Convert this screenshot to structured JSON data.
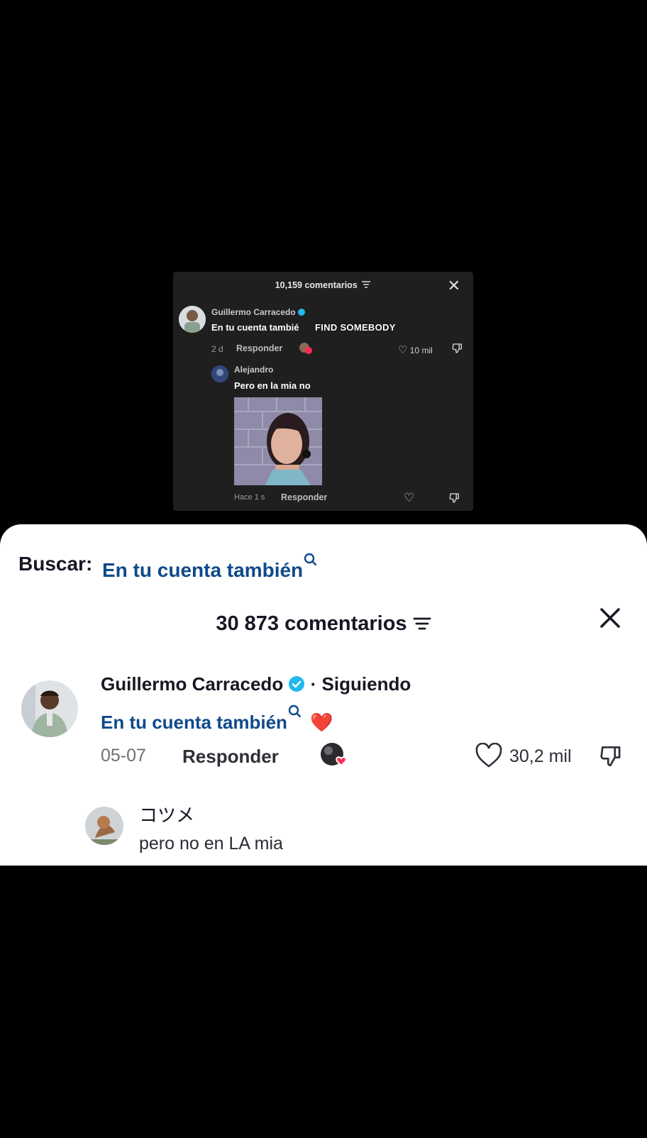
{
  "embedded": {
    "header_count": "10,159 comentarios",
    "comment": {
      "author": "Guillermo Carracedo",
      "text": "En tu cuenta tambié",
      "overlay_text": "FIND SOMEBODY",
      "time": "2 d",
      "reply_label": "Responder",
      "likes": "10 mil"
    },
    "reply": {
      "author": "Alejandro",
      "text": "Pero en la mia no",
      "time": "Hace 1 s",
      "reply_label": "Responder"
    }
  },
  "sheet": {
    "search_label": "Buscar:",
    "search_term": "En tu cuenta también",
    "count": "30 873 comentarios",
    "comment": {
      "author": "Guillermo Carracedo",
      "following": "· Siguiendo",
      "text": "En tu cuenta también",
      "emoji": "❤️",
      "date": "05-07",
      "reply_label": "Responder",
      "likes": "30,2 mil"
    },
    "reply": {
      "author": "コツメ",
      "text": "pero no en LA mia"
    }
  },
  "colors": {
    "link_blue": "#0f4a8a",
    "verified": "#20b8ee",
    "like_pink": "#ff2c55"
  }
}
